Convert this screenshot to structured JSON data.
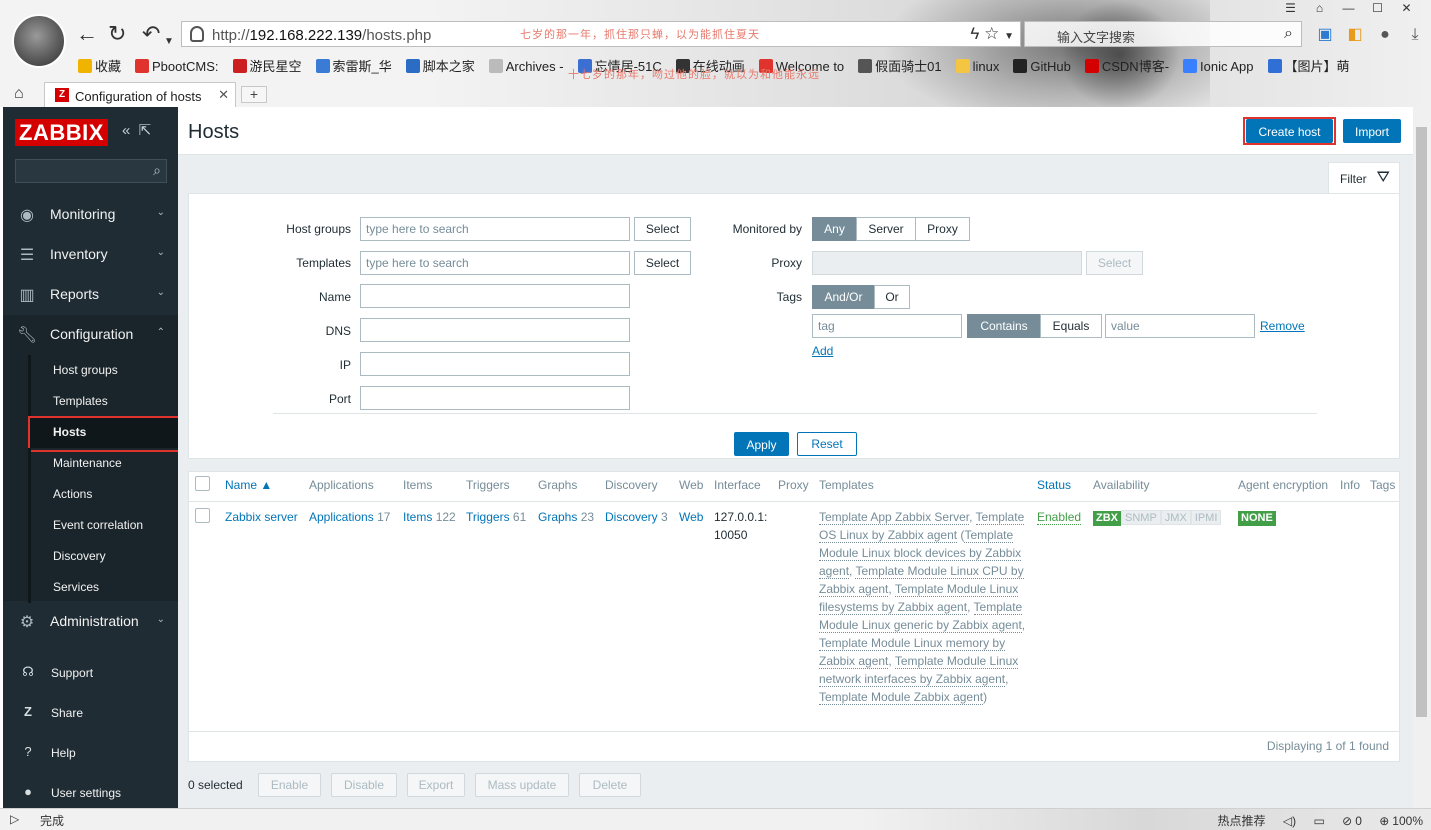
{
  "browser": {
    "url_prefix": "http://",
    "url_host": "192.168.222.139",
    "url_path": "/hosts.php",
    "address_slogan": "七岁的那一年，抓住那只蝉，以为能抓住夏天",
    "search_placeholder": "输入文字搜索",
    "bookmarks_slogan": "十七岁的那年，吻过他的脸，就以为和他能永远",
    "bookmarks": [
      {
        "label": "收藏",
        "color": "#f0b400"
      },
      {
        "label": "PbootCMS:",
        "color": "#e0332e"
      },
      {
        "label": "游民星空",
        "color": "#cc2020"
      },
      {
        "label": "索雷斯_华",
        "color": "#3a7bd5"
      },
      {
        "label": "脚本之家",
        "color": "#2b6cc4"
      },
      {
        "label": "Archives -",
        "color": "#bbbbbb"
      },
      {
        "label": "忘情居-51C",
        "color": "#3b6fd1"
      },
      {
        "label": "在线动画",
        "color": "#333333"
      },
      {
        "label": "Welcome to",
        "color": "#e0332e"
      },
      {
        "label": "假面骑士01",
        "color": "#555555"
      },
      {
        "label": "linux",
        "color": "#f4c542"
      },
      {
        "label": "GitHub",
        "color": "#222222"
      },
      {
        "label": "CSDN博客-",
        "color": "#d40000"
      },
      {
        "label": "Ionic App",
        "color": "#3880ff"
      },
      {
        "label": "【图片】萌",
        "color": "#2f6fd6"
      }
    ],
    "tab_title": "Configuration of hosts",
    "status_left": "完成",
    "status_hot": "热点推荐",
    "status_count": "0",
    "status_zoom": "100%"
  },
  "sidebar": {
    "logo": "ZABBIX",
    "menu": [
      {
        "label": "Monitoring"
      },
      {
        "label": "Inventory"
      },
      {
        "label": "Reports"
      },
      {
        "label": "Configuration"
      }
    ],
    "submenu": [
      {
        "label": "Host groups"
      },
      {
        "label": "Templates"
      },
      {
        "label": "Hosts"
      },
      {
        "label": "Maintenance"
      },
      {
        "label": "Actions"
      },
      {
        "label": "Event correlation"
      },
      {
        "label": "Discovery"
      },
      {
        "label": "Services"
      }
    ],
    "admin": "Administration",
    "bottom": [
      {
        "label": "Support"
      },
      {
        "label": "Share"
      },
      {
        "label": "Help"
      },
      {
        "label": "User settings"
      }
    ]
  },
  "page": {
    "title": "Hosts",
    "create_host": "Create host",
    "import": "Import",
    "filter_tab": "Filter"
  },
  "filter": {
    "host_groups_label": "Host groups",
    "host_groups_placeholder": "type here to search",
    "templates_label": "Templates",
    "templates_placeholder": "type here to search",
    "select": "Select",
    "name_label": "Name",
    "dns_label": "DNS",
    "ip_label": "IP",
    "port_label": "Port",
    "monitored_by_label": "Monitored by",
    "monitored_by_options": [
      "Any",
      "Server",
      "Proxy"
    ],
    "proxy_label": "Proxy",
    "tags_label": "Tags",
    "tags_mode": [
      "And/Or",
      "Or"
    ],
    "tag_placeholder": "tag",
    "tag_ops": [
      "Contains",
      "Equals"
    ],
    "value_placeholder": "value",
    "remove": "Remove",
    "add": "Add",
    "apply": "Apply",
    "reset": "Reset"
  },
  "table": {
    "headers": [
      "Name ▲",
      "Applications",
      "Items",
      "Triggers",
      "Graphs",
      "Discovery",
      "Web",
      "Interface",
      "Proxy",
      "Templates",
      "Status",
      "Availability",
      "Agent encryption",
      "Info",
      "Tags"
    ],
    "row": {
      "name": "Zabbix server",
      "applications": "Applications",
      "applications_count": "17",
      "items": "Items",
      "items_count": "122",
      "triggers": "Triggers",
      "triggers_count": "61",
      "graphs": "Graphs",
      "graphs_count": "23",
      "discovery": "Discovery",
      "discovery_count": "3",
      "web": "Web",
      "interface_line1": "127.0.0.1:",
      "interface_line2": "10050",
      "templates": [
        "Template App Zabbix Server",
        "Template OS Linux by Zabbix agent",
        "Template Module Linux block devices by Zabbix agent",
        "Template Module Linux CPU by Zabbix agent",
        "Template Module Linux filesystems by Zabbix agent",
        "Template Module Linux generic by Zabbix agent",
        "Template Module Linux memory by Zabbix agent",
        "Template Module Linux network interfaces by Zabbix agent",
        "Template Module Zabbix agent"
      ],
      "status": "Enabled",
      "availability": [
        "ZBX",
        "SNMP",
        "JMX",
        "IPMI"
      ],
      "encryption": "NONE"
    },
    "found": "Displaying 1 of 1 found"
  },
  "actions": {
    "selected": "0 selected",
    "buttons": [
      "Enable",
      "Disable",
      "Export",
      "Mass update",
      "Delete"
    ]
  }
}
